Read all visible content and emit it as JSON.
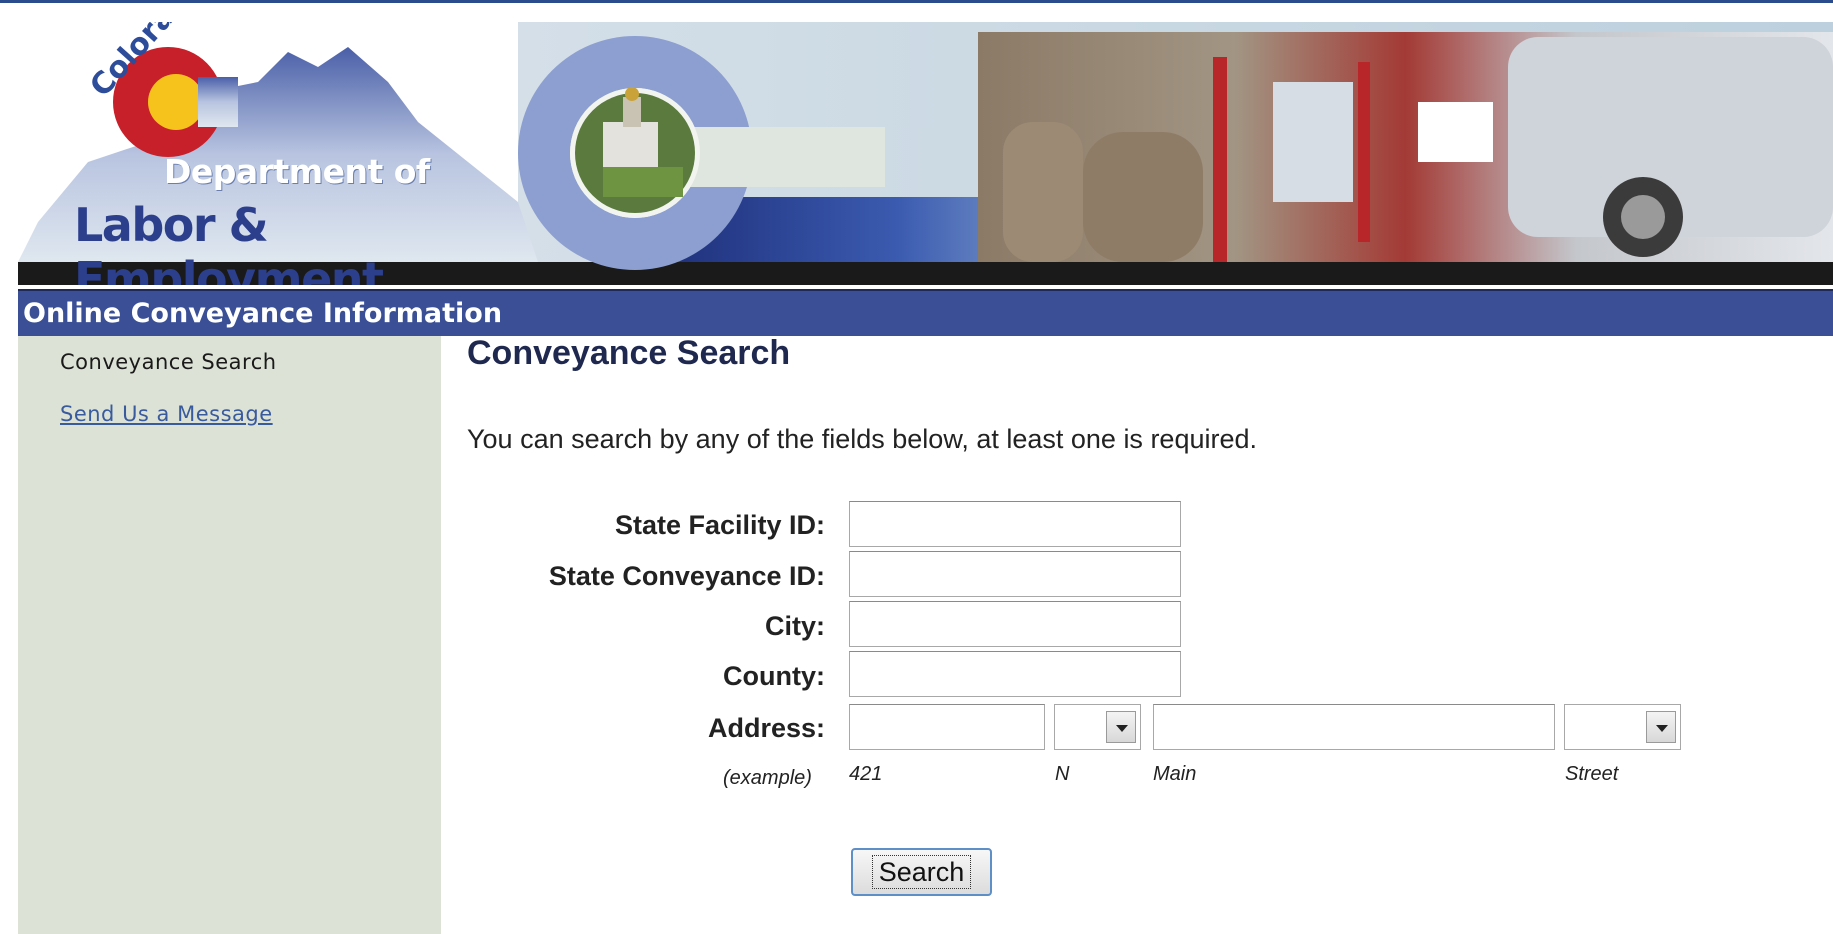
{
  "banner": {
    "state_text": "Colorado",
    "dept_line1": "Department of",
    "dept_line2": "Labor & Employment"
  },
  "titlebar": {
    "title": "Online Conveyance Information"
  },
  "sidebar": {
    "items": [
      {
        "label": "Conveyance Search"
      },
      {
        "label": "Send Us a Message"
      }
    ]
  },
  "main": {
    "title": "Conveyance Search",
    "intro": "You can search by any of the fields below, at least one is required.",
    "fields": {
      "facility_id": {
        "label": "State Facility ID:",
        "value": ""
      },
      "conveyance_id": {
        "label": "State Conveyance ID:",
        "value": ""
      },
      "city": {
        "label": "City:",
        "value": ""
      },
      "county": {
        "label": "County:",
        "value": ""
      },
      "address": {
        "label": "Address:",
        "number_value": "",
        "direction_selected": "",
        "street_name_value": "",
        "street_type_selected": ""
      }
    },
    "example": {
      "label": "(example)",
      "number": "421",
      "direction": "N",
      "street_name": "Main",
      "street_type": "Street"
    },
    "search_label": "Search"
  },
  "colors": {
    "titlebar": "#3a4f96",
    "sidebar": "#dce3d6",
    "link": "#3a5a9e",
    "heading": "#1f2950"
  }
}
